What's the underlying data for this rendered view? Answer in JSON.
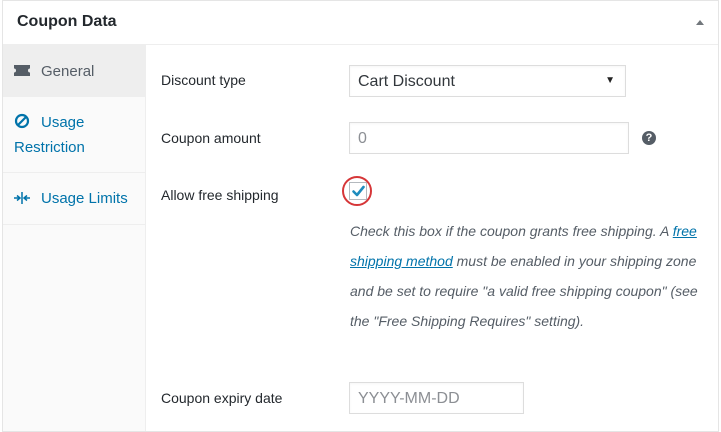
{
  "panel": {
    "title": "Coupon Data"
  },
  "tabs": [
    {
      "label": "General",
      "icon": "ticket-icon",
      "active": true
    },
    {
      "label": "Usage Restriction",
      "icon": "block-icon"
    },
    {
      "label": "Usage Limits",
      "icon": "arrows-in-icon"
    }
  ],
  "general": {
    "discount_type": {
      "label": "Discount type",
      "value": "Cart Discount"
    },
    "coupon_amount": {
      "label": "Coupon amount",
      "value": "0",
      "help": "?"
    },
    "free_shipping": {
      "label": "Allow free shipping",
      "checked": true,
      "desc_before": "Check this box if the coupon grants free shipping. A ",
      "desc_link": "free shipping method",
      "desc_after": " must be enabled in your shipping zone and be set to require \"a valid free shipping coupon\" (see the \"Free Shipping Requires\" setting)."
    },
    "expiry_date": {
      "label": "Coupon expiry date",
      "placeholder": "YYYY-MM-DD"
    }
  },
  "colors": {
    "link": "#0073aa",
    "active_tab_bg": "#eeeeee",
    "highlight": "#d63638",
    "checkmark": "#1e8cbe"
  }
}
